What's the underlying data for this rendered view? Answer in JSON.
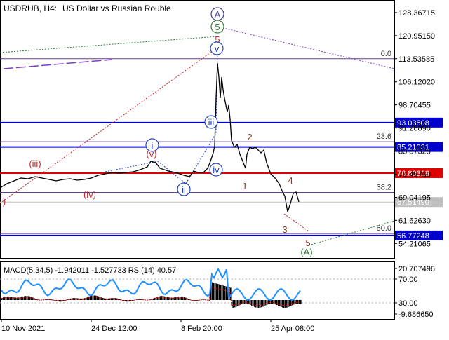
{
  "header": {
    "symbol": "USDRUB, H4:",
    "description": "US Dollar vs Russian Rouble"
  },
  "price_axis": {
    "ticks": [
      "128.36715",
      "120.95150",
      "113.53585",
      "106.12020",
      "98.70455",
      "91.28890",
      "83.87325",
      "76.45760",
      "69.04195",
      "61.62630",
      "54.21065"
    ],
    "min": 50.0,
    "max": 131.5
  },
  "levels": [
    {
      "label": "93.03508",
      "value": 93.03508,
      "color": "#0000cc",
      "badge": true
    },
    {
      "label": "85.21031",
      "value": 85.21031,
      "color": "#0000cc",
      "badge": true
    },
    {
      "label": "76.80318",
      "value": 76.80318,
      "color": "#dd0000",
      "badge": true
    },
    {
      "label": "67.51490",
      "value": 67.5149,
      "color": "#c0c0c0",
      "badge": true
    },
    {
      "label": "56.77248",
      "value": 56.77248,
      "color": "#0000cc",
      "badge": true
    }
  ],
  "fib_levels": [
    {
      "label": "0.0",
      "value": 113.53585
    },
    {
      "label": "23.6",
      "value": 86.9
    },
    {
      "label": "38.2",
      "value": 70.6
    },
    {
      "label": "50.0",
      "value": 57.4
    }
  ],
  "wave_labels": [
    {
      "text": "A",
      "style": "circle",
      "color": "#3b3b8f"
    },
    {
      "text": "5",
      "style": "circle",
      "color": "#2e7d32"
    },
    {
      "text": "5",
      "style": "plain",
      "color": "#c62828"
    },
    {
      "text": "v",
      "style": "circle",
      "color": "#1f3fbf"
    },
    {
      "text": "iii",
      "style": "circle",
      "color": "#1f3fbf"
    },
    {
      "text": "iv",
      "style": "circle",
      "color": "#1f3fbf"
    },
    {
      "text": "i",
      "style": "circle",
      "color": "#1f3fbf"
    },
    {
      "text": "ii",
      "style": "circle",
      "color": "#1f3fbf"
    },
    {
      "text": "(v)",
      "style": "plain",
      "color": "#c62828"
    },
    {
      "text": "(iii)",
      "style": "plain",
      "color": "#c62828"
    },
    {
      "text": "(iv)",
      "style": "plain",
      "color": "#c62828"
    },
    {
      "text": ")",
      "style": "plain",
      "color": "#c62828"
    },
    {
      "text": "1",
      "style": "plain",
      "color": "#8b3a2a"
    },
    {
      "text": "2",
      "style": "plain",
      "color": "#8b3a2a"
    },
    {
      "text": "3",
      "style": "plain",
      "color": "#8b3a2a"
    },
    {
      "text": "4",
      "style": "plain",
      "color": "#8b3a2a"
    },
    {
      "text": "5",
      "style": "plain",
      "color": "#8b3a2a"
    },
    {
      "text": "(A)",
      "style": "plain",
      "color": "#2e7d32"
    }
  ],
  "indicator": {
    "label": "MACD(5,34,5) -1.942011 -1.527733 RSI(14) 40.57",
    "ticks": [
      "20.707496",
      "70.00",
      "30.00",
      "-9.686650"
    ]
  },
  "time_axis": {
    "ticks": [
      "10 Nov 2021",
      "24 Dec 12:00",
      "8 Feb 20:00",
      "25 Apr 08:00"
    ]
  },
  "colors": {
    "price_line": "#000000",
    "level_blue": "#0000cc",
    "level_red": "#dd0000",
    "rsi": "#1e90ff",
    "macd_hist": "#000000",
    "macd_signal": "#dd0000",
    "forecast_green": "#2e7d32",
    "forecast_purple": "#7a3fbf",
    "forecast_red": "#cc2222"
  }
}
